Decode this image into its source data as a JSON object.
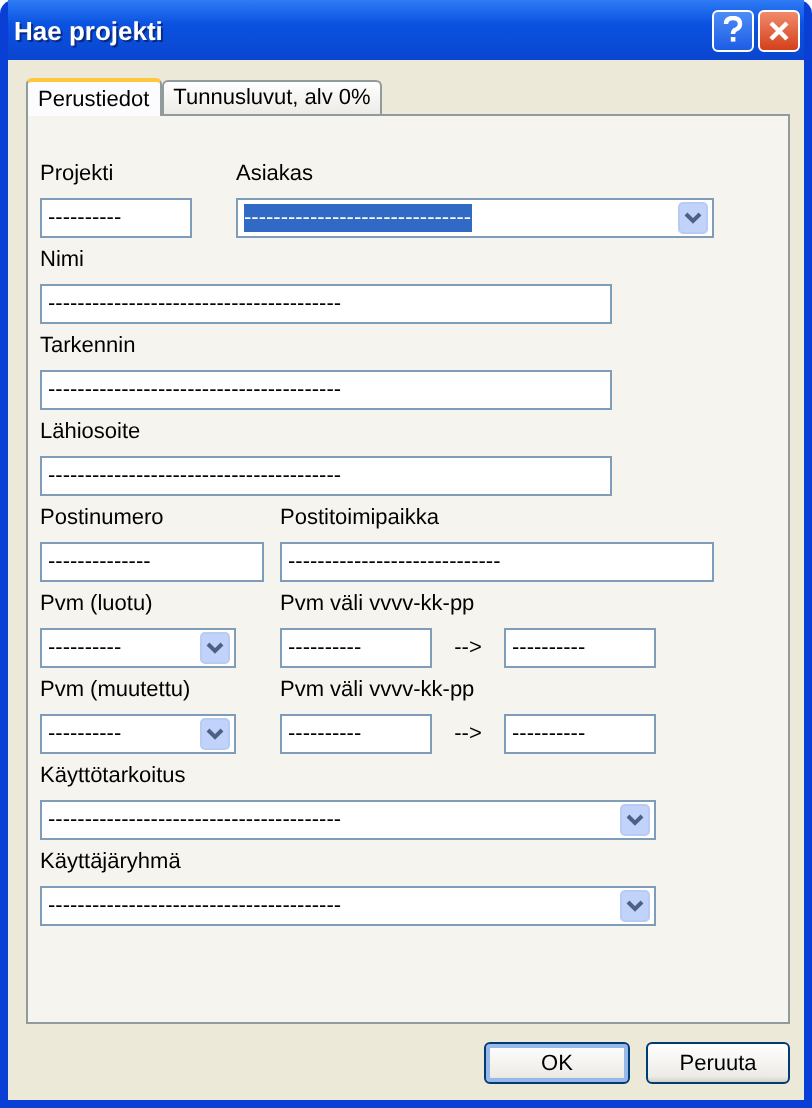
{
  "window": {
    "title": "Hae projekti"
  },
  "tabs": [
    {
      "label": "Perustiedot",
      "selected": true
    },
    {
      "label": "Tunnusluvut, alv 0%",
      "selected": false
    }
  ],
  "rows": [
    [
      {
        "label": "Projekti",
        "kind": "text",
        "value": "----------",
        "highlighted": false
      },
      {
        "label": "Asiakas",
        "kind": "combo",
        "value": "-------------------------------",
        "highlighted": true
      }
    ],
    [
      {
        "label": "Nimi",
        "kind": "text",
        "value": "----------------------------------------",
        "highlighted": false
      }
    ],
    [
      {
        "label": "Tarkennin",
        "kind": "text",
        "value": "----------------------------------------",
        "highlighted": false
      }
    ],
    [
      {
        "label": "Lähiosoite",
        "kind": "text",
        "value": "----------------------------------------",
        "highlighted": false
      }
    ],
    [
      {
        "label": "Postinumero",
        "kind": "text",
        "value": "--------------",
        "highlighted": false
      },
      {
        "label": "Postitoimipaikka",
        "kind": "text",
        "value": "-----------------------------",
        "highlighted": false
      }
    ],
    [
      {
        "label": "Pvm (luotu)",
        "kind": "combo",
        "value": "----------",
        "highlighted": false
      },
      {
        "label": "Pvm väli vvvv-kk-pp",
        "kind": "range",
        "value": "----------",
        "separator": "-->",
        "value_to": "----------",
        "highlighted": false
      }
    ],
    [
      {
        "label": "Pvm (muutettu)",
        "kind": "combo",
        "value": "----------",
        "highlighted": false
      },
      {
        "label": "Pvm väli vvvv-kk-pp",
        "kind": "range",
        "value": "----------",
        "separator": "-->",
        "value_to": "----------",
        "highlighted": false
      }
    ],
    [
      {
        "label": "Käyttötarkoitus",
        "kind": "combo",
        "value": "----------------------------------------",
        "highlighted": false
      }
    ],
    [
      {
        "label": "Käyttäjäryhmä",
        "kind": "combo",
        "value": "----------------------------------------",
        "highlighted": false
      }
    ]
  ],
  "buttons": [
    {
      "label": "OK",
      "default": true
    },
    {
      "label": "Peruuta",
      "default": false
    }
  ]
}
